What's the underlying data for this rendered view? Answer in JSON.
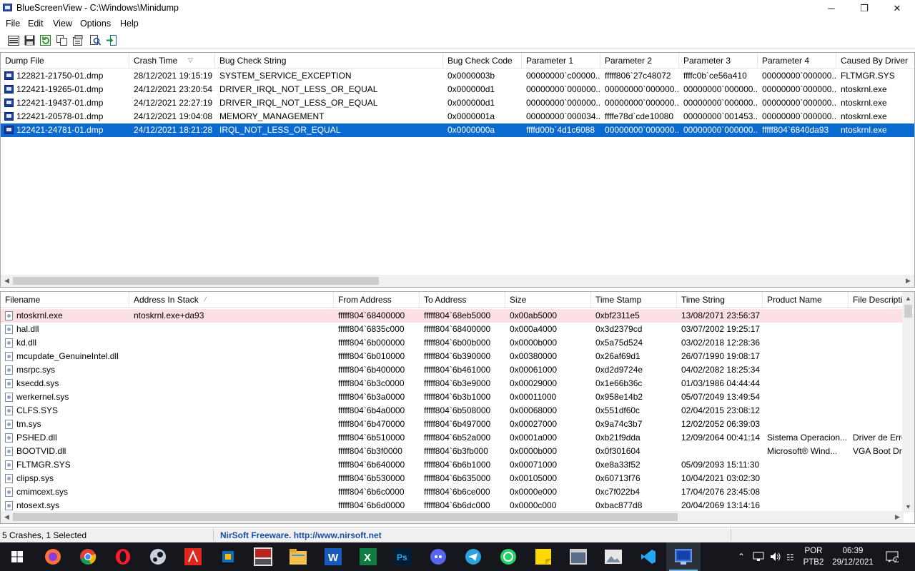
{
  "window": {
    "title": "BlueScreenView - C:\\Windows\\Minidump",
    "minimize_glyph": "─",
    "maximize_glyph": "❐",
    "close_glyph": "✕"
  },
  "menu": [
    "File",
    "Edit",
    "View",
    "Options",
    "Help"
  ],
  "toolbar_icons": [
    "html-report-icon",
    "save-icon",
    "refresh-icon",
    "copy-icon",
    "properties-icon",
    "find-icon",
    "exit-icon"
  ],
  "crashes": {
    "columns": [
      "Dump File",
      "Crash Time",
      "Bug Check String",
      "Bug Check Code",
      "Parameter 1",
      "Parameter 2",
      "Parameter 3",
      "Parameter 4",
      "Caused By Driver"
    ],
    "sorted_column": "Crash Time",
    "rows": [
      [
        "122821-21750-01.dmp",
        "28/12/2021 19:15:19",
        "SYSTEM_SERVICE_EXCEPTION",
        "0x0000003b",
        "00000000`c00000...",
        "fffff806`27c48072",
        "ffffc0b`ce56a410",
        "00000000`000000...",
        "FLTMGR.SYS"
      ],
      [
        "122421-19265-01.dmp",
        "24/12/2021 23:20:54",
        "DRIVER_IRQL_NOT_LESS_OR_EQUAL",
        "0x000000d1",
        "00000000`000000...",
        "00000000`000000...",
        "00000000`000000...",
        "00000000`000000...",
        "ntoskrnl.exe"
      ],
      [
        "122421-19437-01.dmp",
        "24/12/2021 22:27:19",
        "DRIVER_IRQL_NOT_LESS_OR_EQUAL",
        "0x000000d1",
        "00000000`000000...",
        "00000000`000000...",
        "00000000`000000...",
        "00000000`000000...",
        "ntoskrnl.exe"
      ],
      [
        "122421-20578-01.dmp",
        "24/12/2021 19:04:08",
        "MEMORY_MANAGEMENT",
        "0x0000001a",
        "00000000`000034...",
        "ffffe78d`cde10080",
        "00000000`001453...",
        "00000000`000000...",
        "ntoskrnl.exe"
      ],
      [
        "122421-24781-01.dmp",
        "24/12/2021 18:21:28",
        "IRQL_NOT_LESS_OR_EQUAL",
        "0x0000000a",
        "ffffd00b`4d1c6088",
        "00000000`000000...",
        "00000000`000000...",
        "fffff804`6840da93",
        "ntoskrnl.exe"
      ]
    ],
    "selected_index": 4
  },
  "drivers": {
    "columns": [
      "Filename",
      "Address In Stack",
      "From Address",
      "To Address",
      "Size",
      "Time Stamp",
      "Time String",
      "Product Name",
      "File Descripti"
    ],
    "sorted_column": "Address In Stack",
    "rows": [
      [
        "ntoskrnl.exe",
        "ntoskrnl.exe+da93",
        "fffff804`68400000",
        "fffff804`68eb5000",
        "0x00ab5000",
        "0xbf2311e5",
        "13/08/2071 23:56:37",
        "",
        ""
      ],
      [
        "hal.dll",
        "",
        "fffff804`6835c000",
        "fffff804`68400000",
        "0x000a4000",
        "0x3d2379cd",
        "03/07/2002 19:25:17",
        "",
        ""
      ],
      [
        "kd.dll",
        "",
        "fffff804`6b000000",
        "fffff804`6b00b000",
        "0x0000b000",
        "0x5a75d524",
        "03/02/2018 12:28:36",
        "",
        ""
      ],
      [
        "mcupdate_GenuineIntel.dll",
        "",
        "fffff804`6b010000",
        "fffff804`6b390000",
        "0x00380000",
        "0x26af69d1",
        "26/07/1990 19:08:17",
        "",
        ""
      ],
      [
        "msrpc.sys",
        "",
        "fffff804`6b400000",
        "fffff804`6b461000",
        "0x00061000",
        "0xd2d9724e",
        "04/02/2082 18:25:34",
        "",
        ""
      ],
      [
        "ksecdd.sys",
        "",
        "fffff804`6b3c0000",
        "fffff804`6b3e9000",
        "0x00029000",
        "0x1e66b36c",
        "01/03/1986 04:44:44",
        "",
        ""
      ],
      [
        "werkernel.sys",
        "",
        "fffff804`6b3a0000",
        "fffff804`6b3b1000",
        "0x00011000",
        "0x958e14b2",
        "05/07/2049 13:49:54",
        "",
        ""
      ],
      [
        "CLFS.SYS",
        "",
        "fffff804`6b4a0000",
        "fffff804`6b508000",
        "0x00068000",
        "0x551df60c",
        "02/04/2015 23:08:12",
        "",
        ""
      ],
      [
        "tm.sys",
        "",
        "fffff804`6b470000",
        "fffff804`6b497000",
        "0x00027000",
        "0x9a74c3b7",
        "12/02/2052 06:39:03",
        "",
        ""
      ],
      [
        "PSHED.dll",
        "",
        "fffff804`6b510000",
        "fffff804`6b52a000",
        "0x0001a000",
        "0xb21f9dda",
        "12/09/2064 00:41:14",
        "Sistema Operacion...",
        "Driver de Erro"
      ],
      [
        "BOOTVID.dll",
        "",
        "fffff804`6b3f0000",
        "fffff804`6b3fb000",
        "0x0000b000",
        "0x0f301604",
        "",
        "Microsoft® Wind...",
        "VGA Boot Dri"
      ],
      [
        "FLTMGR.SYS",
        "",
        "fffff804`6b640000",
        "fffff804`6b6b1000",
        "0x00071000",
        "0xe8a33f52",
        "05/09/2093 15:11:30",
        "",
        ""
      ],
      [
        "clipsp.sys",
        "",
        "fffff804`6b530000",
        "fffff804`6b635000",
        "0x00105000",
        "0x60713f76",
        "10/04/2021 03:02:30",
        "",
        ""
      ],
      [
        "cmimcext.sys",
        "",
        "fffff804`6b6c0000",
        "fffff804`6b6ce000",
        "0x0000e000",
        "0xc7f022b4",
        "17/04/2076 23:45:08",
        "",
        ""
      ],
      [
        "ntosext.sys",
        "",
        "fffff804`6b6d0000",
        "fffff804`6b6dc000",
        "0x0000c000",
        "0xbac877d8",
        "20/04/2069 13:14:16",
        "",
        ""
      ]
    ],
    "highlight_index": 0
  },
  "status": {
    "summary": "5 Crashes, 1 Selected",
    "link": "NirSoft Freeware.  http://www.nirsoft.net"
  },
  "taskbar": {
    "apps": [
      "windows-start-icon",
      "firefox-icon",
      "chrome-icon",
      "opera-icon",
      "steam-icon",
      "adobe-acrobat-icon",
      "app-blue-icon",
      "bim-sight-icon",
      "file-explorer-icon",
      "word-icon",
      "excel-icon",
      "photoshop-icon",
      "discord-icon",
      "telegram-icon",
      "whatsapp-icon",
      "sticky-notes-icon",
      "app-window-icon",
      "photos-icon",
      "vscode-icon",
      "bluescreenview-icon"
    ],
    "language_line1": "POR",
    "language_line2": "PTB2",
    "time": "06:39",
    "date": "29/12/2021"
  },
  "colors": {
    "selection": "#0a6ad0",
    "highlight_row": "#fde0e4",
    "taskbar": "#15171c",
    "nirsoft_link": "#1a4fa8"
  }
}
